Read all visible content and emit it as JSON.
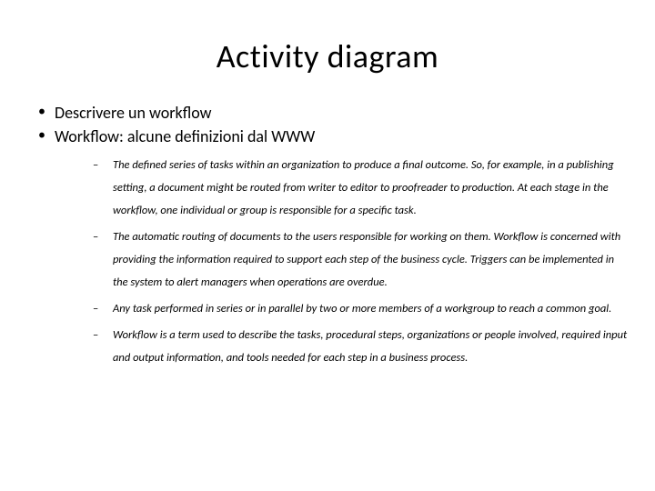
{
  "title": "Activity diagram",
  "bullets": [
    {
      "text": "Descrivere un workflow"
    },
    {
      "text": "Workflow: alcune definizioni dal WWW"
    }
  ],
  "sub_bullets": [
    {
      "text": "The defined series of tasks within an organization to produce a final outcome. So, for example, in a publishing setting, a document might be routed from writer to editor to proofreader to production. At each stage in the workflow, one individual or group is responsible for a specific task."
    },
    {
      "text": "The automatic routing of documents to the users responsible for working on them. Workflow is concerned with providing the information required to support each step of the business cycle. Triggers can be implemented in the system to alert managers when operations are overdue."
    },
    {
      "text": "Any task performed in series or in parallel by two or more members of a workgroup to reach a common goal."
    },
    {
      "text": "Workflow is a term used to describe the tasks, procedural steps, organizations or people involved, required input and output information, and tools needed for each step in a business process."
    }
  ]
}
